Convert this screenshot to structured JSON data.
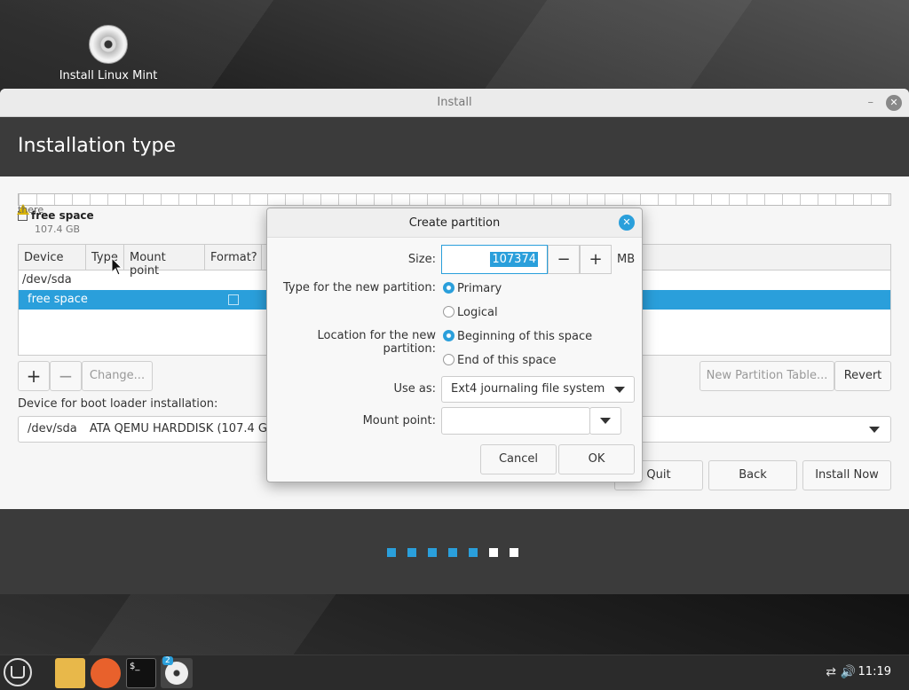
{
  "desktop": {
    "icon_label": "Install Linux Mint"
  },
  "window": {
    "title": "Install",
    "minimize": "–",
    "close": "✕"
  },
  "page": {
    "title": "Installation type"
  },
  "legend": {
    "ghost_label": "there",
    "name": "free space",
    "size": "107.4 GB"
  },
  "table": {
    "headers": [
      "Device",
      "Type",
      "Mount point",
      "Format?"
    ],
    "rows": [
      "/dev/sda",
      "free space"
    ]
  },
  "buttons": {
    "add": "+",
    "remove": "−",
    "change": "Change...",
    "new_table": "New Partition Table...",
    "revert": "Revert",
    "quit": "Quit",
    "back": "Back",
    "install_now": "Install Now"
  },
  "bootloader": {
    "label": "Device for boot loader installation:",
    "device": "/dev/sda",
    "description": "ATA QEMU HARDDISK (107.4 GB)"
  },
  "progress": {
    "total_steps": 7,
    "completed_steps": 5
  },
  "dialog": {
    "title": "Create partition",
    "close": "✕",
    "size_label": "Size:",
    "size_value": "107374",
    "size_unit": "MB",
    "minus": "−",
    "plus": "+",
    "type_label": "Type for the new partition:",
    "type_primary": "Primary",
    "type_logical": "Logical",
    "location_label": "Location for the new partition:",
    "location_begin": "Beginning of this space",
    "location_end": "End of this space",
    "use_as_label": "Use as:",
    "use_as_value": "Ext4 journaling file system",
    "mount_label": "Mount point:",
    "mount_value": "",
    "cancel": "Cancel",
    "ok": "OK"
  },
  "taskbar": {
    "badge": "2",
    "clock": "11:19"
  },
  "colors": {
    "accent": "#2a9fdb",
    "header": "#3b3b3b"
  }
}
